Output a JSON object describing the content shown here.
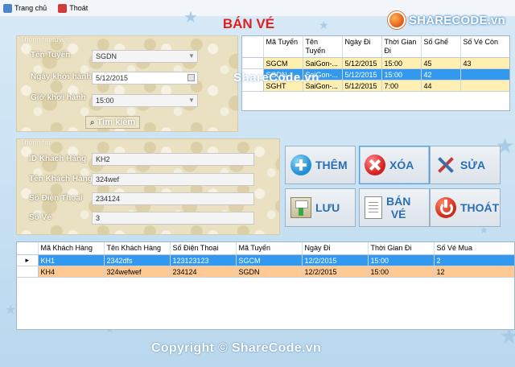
{
  "menu": {
    "home_label": "Trang chủ",
    "exit_label": "Thoát"
  },
  "logo": {
    "text": "SHARECODE.vn"
  },
  "form_title": "BÁN VÉ",
  "route_group": {
    "title": "Thông tin tuyến",
    "route_label": "Tên Tuyến",
    "route_value": "SGDN",
    "date_label": "Ngày khởi hành",
    "date_value": "5/12/2015",
    "time_label": "Giờ khởi hành",
    "time_value": "15:00",
    "search_label": "Tìm kiếm"
  },
  "routes_grid": {
    "columns": [
      "Mã Tuyến",
      "Tên Tuyến",
      "Ngày Đi",
      "Thời Gian Đi",
      "Số Ghế",
      "Số Vé Còn"
    ],
    "rows": [
      [
        "SGCM",
        "SaiGon-...",
        "5/12/2015",
        "15:00",
        "45",
        "43"
      ],
      [
        "SGDN",
        "SaiGon-...",
        "5/12/2015",
        "15:00",
        "42",
        ""
      ],
      [
        "SGHT",
        "SaiGon-...",
        "5/12/2015",
        "7:00",
        "44",
        ""
      ]
    ]
  },
  "watermark_mid": "ShareCode.vn",
  "customer_group": {
    "title": "Thông tin",
    "id_label": "ID Khách Hàng",
    "id_value": "KH2",
    "name_label": "Tên Khách Hàng",
    "name_value": "324wef",
    "phone_label": "Số Điện Thoại",
    "phone_value": "234124",
    "tickets_label": "Số Vé",
    "tickets_value": "3"
  },
  "actions": {
    "add": "THÊM",
    "delete": "XÓA",
    "edit": "SỬA",
    "save": "LƯU",
    "sell_line1": "BÁN",
    "sell_line2": "VÉ",
    "exit": "THOÁT"
  },
  "tickets_grid": {
    "columns": [
      "Mã Khách Hàng",
      "Tên Khách Hàng",
      "Số Điện Thoại",
      "Mã Tuyến",
      "Ngày Đi",
      "Thời Gian Đi",
      "Số Vé Mua"
    ],
    "rows": [
      [
        "KH1",
        "2342dfs",
        "123123123",
        "SGCM",
        "12/2/2015",
        "15:00",
        "2"
      ],
      [
        "KH4",
        "324wefwef",
        "234124",
        "SGDN",
        "12/2/2015",
        "15:00",
        "12"
      ]
    ],
    "current_row_marker": "▸"
  },
  "footer": "Copyright © ShareCode.vn",
  "colors": {
    "title_red": "#e02020",
    "selection_blue": "#3399ee",
    "row_yellow": "#ffefb0",
    "row_orange": "#ffc993"
  }
}
